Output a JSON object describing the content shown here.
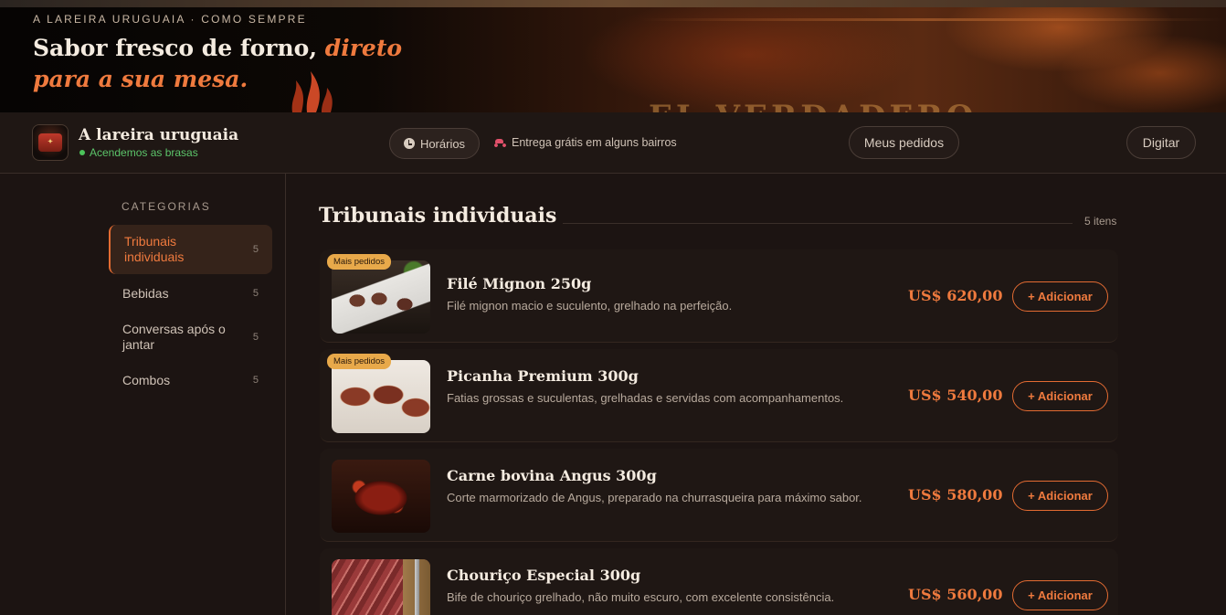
{
  "hero": {
    "kicker": "A LAREIRA URUGUAIA · COMO SEMPRE",
    "headline_plain": "Sabor fresco de forno,",
    "headline_accent": "direto para a sua mesa.",
    "background_text": "EL VERDADERO"
  },
  "header": {
    "brand_name": "A lareira uruguaia",
    "status": "Acendemos as brasas",
    "hours_label": "Horários",
    "delivery_text": "Entrega grátis em alguns bairros",
    "orders_label": "Meus pedidos",
    "login_label": "Digitar"
  },
  "sidebar": {
    "title": "CATEGORIAS",
    "items": [
      {
        "label": "Tribunais individuais",
        "count": "5",
        "active": true
      },
      {
        "label": "Bebidas",
        "count": "5",
        "active": false
      },
      {
        "label": "Conversas após o jantar",
        "count": "5",
        "active": false
      },
      {
        "label": "Combos",
        "count": "5",
        "active": false
      }
    ]
  },
  "main": {
    "section_title": "Tribunais individuais",
    "section_count": "5 itens",
    "add_label": "+ Adicionar",
    "products": [
      {
        "name": "Filé Mignon 250g",
        "description": "Filé mignon macio e suculento, grelhado na perfeição.",
        "price": "US$ 620,00",
        "badge": "Mais pedidos"
      },
      {
        "name": "Picanha Premium 300g",
        "description": "Fatias grossas e suculentas, grelhadas e servidas com acompanhamentos.",
        "price": "US$ 540,00",
        "badge": "Mais pedidos"
      },
      {
        "name": "Carne bovina Angus 300g",
        "description": "Corte marmorizado de Angus, preparado na churrasqueira para máximo sabor.",
        "price": "US$ 580,00",
        "badge": ""
      },
      {
        "name": "Chouriço Especial 300g",
        "description": "Bife de chouriço grelhado, não muito escuro, com excelente consistência.",
        "price": "US$ 560,00",
        "badge": ""
      }
    ]
  },
  "colors": {
    "accent": "#ef7a3e",
    "background": "#1c1412",
    "status_green": "#5cc46a",
    "badge": "#e8a94a"
  },
  "icons": [
    "clock-icon",
    "scooter-icon",
    "flame-icon",
    "logo"
  ]
}
